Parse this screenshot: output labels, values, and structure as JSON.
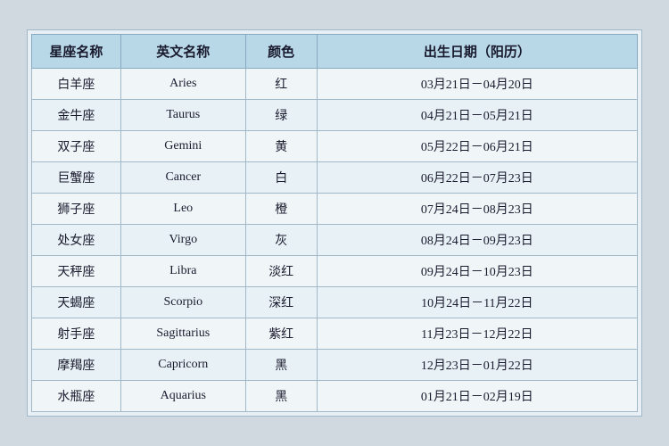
{
  "table": {
    "headers": {
      "zh_name": "星座名称",
      "en_name": "英文名称",
      "color": "颜色",
      "birthdate": "出生日期（阳历）"
    },
    "rows": [
      {
        "zh": "白羊座",
        "en": "Aries",
        "color": "红",
        "date": "03月21日－04月20日"
      },
      {
        "zh": "金牛座",
        "en": "Taurus",
        "color": "绿",
        "date": "04月21日－05月21日"
      },
      {
        "zh": "双子座",
        "en": "Gemini",
        "color": "黄",
        "date": "05月22日－06月21日"
      },
      {
        "zh": "巨蟹座",
        "en": "Cancer",
        "color": "白",
        "date": "06月22日－07月23日"
      },
      {
        "zh": "狮子座",
        "en": "Leo",
        "color": "橙",
        "date": "07月24日－08月23日"
      },
      {
        "zh": "处女座",
        "en": "Virgo",
        "color": "灰",
        "date": "08月24日－09月23日"
      },
      {
        "zh": "天秤座",
        "en": "Libra",
        "color": "淡红",
        "date": "09月24日－10月23日"
      },
      {
        "zh": "天蝎座",
        "en": "Scorpio",
        "color": "深红",
        "date": "10月24日－11月22日"
      },
      {
        "zh": "射手座",
        "en": "Sagittarius",
        "color": "紫红",
        "date": "11月23日－12月22日"
      },
      {
        "zh": "摩羯座",
        "en": "Capricorn",
        "color": "黑",
        "date": "12月23日－01月22日"
      },
      {
        "zh": "水瓶座",
        "en": "Aquarius",
        "color": "黑",
        "date": "01月21日－02月19日"
      }
    ]
  }
}
